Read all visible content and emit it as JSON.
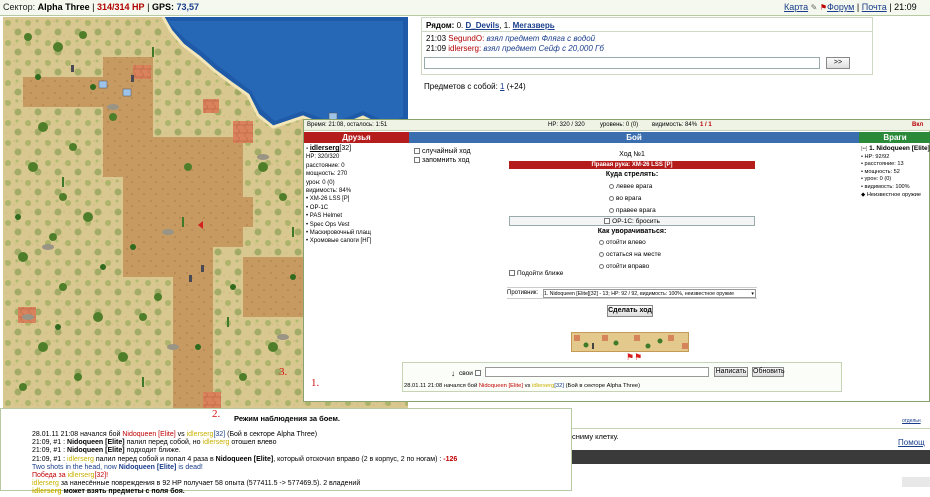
{
  "topbar": {
    "sector_label": "Сектор:",
    "sector_value": "Alpha Three",
    "hp_value": "314",
    "hp_max": "314 HP",
    "gps_label": "GPS:",
    "gps_value": "73,57",
    "map_link": "Карта",
    "forum_link": "Форум",
    "mail_link": "Почта",
    "time": "21:09"
  },
  "nearby": {
    "label": "Рядом:",
    "items": [
      {
        "num": "0.",
        "name": "D_Devils"
      },
      {
        "num": "1.",
        "name": "Мегазверь"
      }
    ]
  },
  "chat_lines": [
    {
      "time": "21:03",
      "user": "SegundO:",
      "msg": "взял предмет Фляга с водой"
    },
    {
      "time": "21:09",
      "user": "idlerserg:",
      "msg": "взял предмет Сейф с 20,000 Гб"
    }
  ],
  "chat_send_label": ">>",
  "items_with_you": {
    "label": "Предметов с собой:",
    "value": "1",
    "extra": "(+24)"
  },
  "battle": {
    "status_time": "Время: 21:08, осталось: 1:51",
    "status_hp": "HP: 320 / 320",
    "status_level": "уровень: 0 (0)",
    "status_visibility": "видимость: 84%",
    "status_turn": "1 / 1",
    "status_right": "Вкл",
    "header_friends": "Друзья",
    "header_battle": "Бой",
    "header_enemies": "Враги",
    "player": {
      "name": "idlerserg",
      "level": "[32]",
      "stats": [
        "HP: 320/320",
        "расстояние: 0",
        "мощность: 270",
        "урон: 0 (0)",
        "видимость: 84%"
      ],
      "items": [
        "XM-26 LSS [P]",
        "OP-1C",
        "PAS Helmet",
        "Spec Ops Vest",
        "Маскировочный плащ",
        "Хромовые сапоги [НГ]"
      ]
    },
    "random_move": "случайный ход",
    "remember_move": "запомнить ход",
    "turn_title": "Ход №1",
    "right_hand": "Правая рука: XM-26 LSS [P]",
    "where_shoot": "Куда стрелять:",
    "shoot_options": [
      "левее врага",
      "во врага",
      "правее врага"
    ],
    "throw_option": "OP-1C: бросить",
    "dodge_title": "Как уворачиваться:",
    "dodge_options": [
      "отойти влево",
      "остаться на месте",
      "отойти вправо"
    ],
    "approach": "Подойти ближе",
    "opponent_label": "Противник:",
    "opponent_value": "1. Nidoqueen [Elite][32] - 13; HP: 92 / 92, видимость: 100%, неизвестное оружие",
    "make_move": "Сделать ход",
    "enemy": {
      "name": "1. Nidoqueen [Elite]",
      "stats": [
        "HP: 92/92",
        "расстояние: 13",
        "мощность: 52",
        "урон: 0 (0)",
        "видимость: 100%"
      ],
      "weapon": "Неизвестное оружие"
    },
    "own_label": "свои",
    "write_button": "Написать",
    "refresh_button": "Обновить",
    "log_line": {
      "date": "28.01.11 21:08 начался бой",
      "player1": "Nidoqueen [Elite]",
      "vs": "vs",
      "player2": "idlerserg",
      "level": "[32]",
      "tail": "(Бой в секторе Alpha Three)"
    }
  },
  "markers": {
    "one": "1.",
    "two": "2.",
    "three": "3."
  },
  "observe_title": "Режим наблюдения за боем.",
  "bottom_log": {
    "l1_date": "28.01.11 21:08 начался бой",
    "l1_p1": "Nidoqueen [Elite]",
    "l1_vs": "vs",
    "l1_p2": "idlerserg",
    "l1_lvl": "[32]",
    "l1_tail": "(Бой в секторе Alpha Three)",
    "l2": "21:09, #1 : Nidoqueen [Elite] палил перед собой, но idlerserg отошел влево",
    "l2_time": "21:09, #1 :",
    "l2_p1": "Nidoqueen [Elite]",
    "l2_mid": "палил перед собой, но",
    "l2_p2": "idlerserg",
    "l2_tail": "отошел влево",
    "l3_time": "21:09, #1 :",
    "l3_p1": "Nidoqueen [Elite]",
    "l3_tail": "подходит ближе.",
    "l4_time": "21:09, #1 :",
    "l4_p1": "idlerserg",
    "l4_mid": "палил перед собой и попал 4 раза в",
    "l4_p2": "Nidoqueen [Elite]",
    "l4_tail": ", который отскочил вправо (2 в корпус, 2 по ногам) :",
    "l4_dmg": "-126",
    "l5_a": "Two shots in the head, now",
    "l5_p": "Nidoqueen [Elite]",
    "l5_b": "is dead!",
    "l6_a": "Победа за",
    "l6_p": "idlerserg",
    "l6_lvl": "[32]!",
    "l7_p": "idlerserg",
    "l7_tail": "за нанесённые повреждения в 92 HP получает 58 опыта (577411.5 -> 577469.5). 2 владений",
    "l8_p": "idlerserg",
    "l8_tail": "может взять предметы с поля боя."
  },
  "lower_right": {
    "cell_text": "сниму клетку.",
    "help_link": "Помощ",
    "small_link": "отдельн"
  }
}
